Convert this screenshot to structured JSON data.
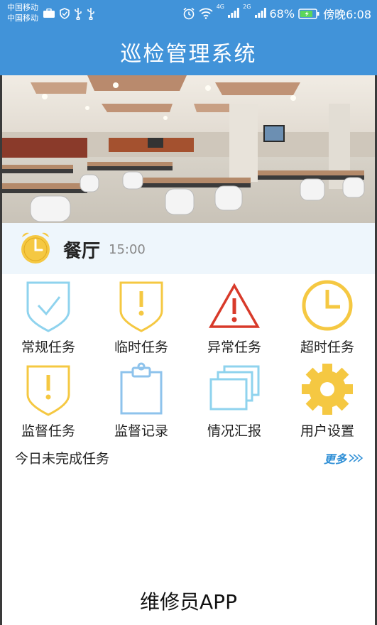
{
  "status_bar": {
    "carrier_1": "中国移动",
    "carrier_2": "中国移动",
    "network_1": "4G",
    "network_2": "2G",
    "battery": "68%",
    "time": "傍晚6:08"
  },
  "header": {
    "title": "巡检管理系统"
  },
  "location": {
    "name": "餐厅",
    "time": "15:00"
  },
  "menu": {
    "items": [
      {
        "label": "常规任务",
        "icon": "shield-check-icon"
      },
      {
        "label": "临时任务",
        "icon": "shield-exclamation-icon"
      },
      {
        "label": "异常任务",
        "icon": "warning-triangle-icon"
      },
      {
        "label": "超时任务",
        "icon": "clock-icon"
      },
      {
        "label": "监督任务",
        "icon": "shield-exclamation-icon"
      },
      {
        "label": "监督记录",
        "icon": "clipboard-icon"
      },
      {
        "label": "情况汇报",
        "icon": "stacked-cards-icon"
      },
      {
        "label": "用户设置",
        "icon": "gear-icon"
      }
    ]
  },
  "today": {
    "label": "今日未完成任务",
    "more": "更多"
  },
  "footer": {
    "caption": "维修员APP"
  },
  "colors": {
    "header": "#4193d9",
    "accent_yellow": "#f5c842",
    "accent_blue": "#8fd3ee",
    "alert_red": "#d83a2a",
    "location_bg": "#eef6fc"
  }
}
